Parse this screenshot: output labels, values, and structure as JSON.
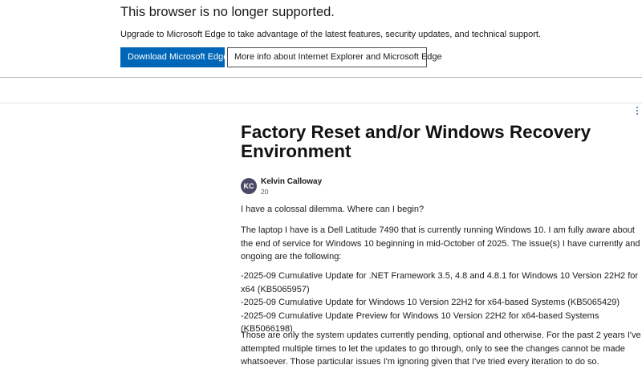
{
  "banner": {
    "title": "This browser is no longer supported.",
    "text": "Upgrade to Microsoft Edge to take advantage of the latest features, security updates, and technical support.",
    "primary_button": "Download Microsoft Edge",
    "secondary_button": "More info about Internet Explorer and Microsoft Edge"
  },
  "post": {
    "title": "Factory Reset and/or Windows Recovery Environment",
    "author": {
      "initials": "KC",
      "name": "Kelvin Calloway",
      "meta": "20"
    },
    "paragraphs": [
      "I have a colossal dilemma. Where can I begin?",
      "The laptop I have is a Dell Latitude 7490 that is currently running Windows 10. I am fully aware about the end of service for Windows 10 beginning in mid-October of 2025. The issue(s) I have currently and ongoing are the following:",
      "Those are only the system updates currently pending, optional and otherwise. For the past 2 years I've attempted multiple times to let the updates to go through, only to see the changes cannot be made whatsoever. Those particular issues I'm ignoring given that I've tried every iteration to do so."
    ],
    "update_lines": [
      "-2025-09 Cumulative Update for .NET Framework 3.5, 4.8 and 4.8.1 for Windows 10 Version 22H2 for x64 (KB5065957)",
      "-2025-09 Cumulative Update for Windows 10 Version 22H2 for x64-based Systems (KB5065429)",
      "-2025-09 Cumulative Update Preview for Windows 10 Version 22H2 for x64-based Systems (KB5066198)"
    ]
  },
  "colors": {
    "accent": "#0067b8",
    "avatar_bg": "#4a4a68"
  }
}
